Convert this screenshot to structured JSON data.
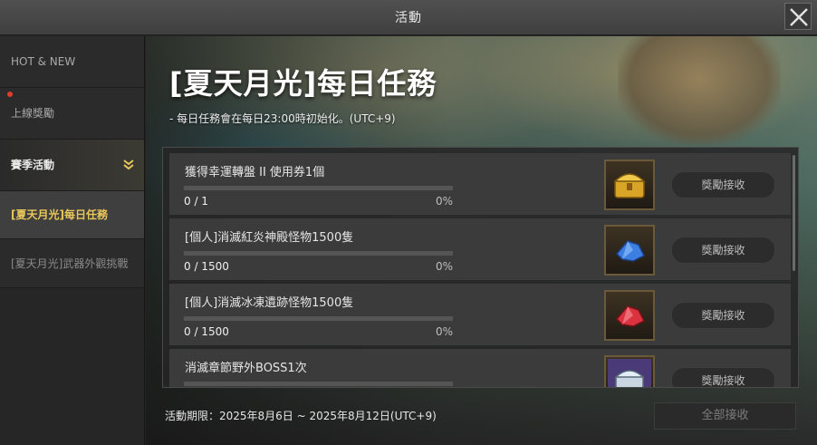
{
  "window": {
    "title": "活動"
  },
  "sidebar": {
    "items": [
      {
        "label": "HOT & NEW"
      },
      {
        "label": "上線獎勵",
        "has_notification": true
      },
      {
        "label": "賽季活動"
      },
      {
        "label": "[夏天月光]每日任務",
        "active": true
      },
      {
        "label": "[夏天月光]武器外觀挑戰"
      }
    ]
  },
  "main": {
    "title": "[夏天月光]每日任務",
    "reset_note": "- 每日任務會在每日23:00時初始化。(UTC+9)",
    "tasks": [
      {
        "name": "獲得幸運轉盤 II 使用券1個",
        "count": "0 / 1",
        "percent": "0%",
        "progress": 0,
        "reward_icon": "golden-chest-icon",
        "claim_label": "獎勵接收"
      },
      {
        "name": "[個人]消滅紅炎神殿怪物1500隻",
        "count": "0 / 1500",
        "percent": "0%",
        "progress": 0,
        "reward_icon": "blue-crystal-icon",
        "claim_label": "獎勵接收"
      },
      {
        "name": "[個人]消滅冰凍遺跡怪物1500隻",
        "count": "0 / 1500",
        "percent": "0%",
        "progress": 0,
        "reward_icon": "red-crystal-icon",
        "claim_label": "獎勵接收"
      },
      {
        "name": "消滅章節野外BOSS1次",
        "count": "",
        "percent": "",
        "progress": 0,
        "reward_icon": "silver-chest-icon",
        "claim_label": "獎勵接收"
      }
    ],
    "period": "活動期限：2025年8月6日 ~ 2025年8月12日(UTC+9)",
    "claim_all_label": "全部接收"
  },
  "colors": {
    "accent": "#e9c75a",
    "notification": "#e23b2b",
    "progress": "#c9a640"
  }
}
